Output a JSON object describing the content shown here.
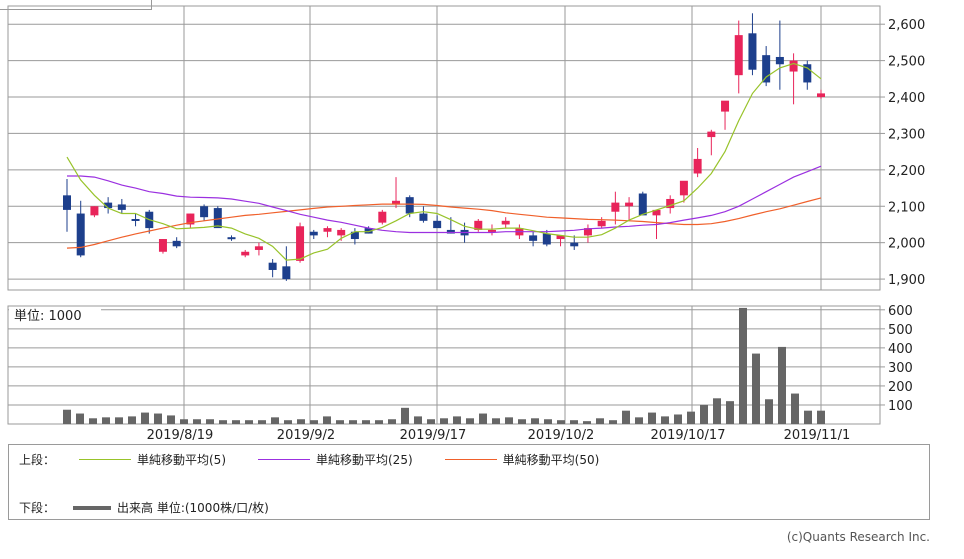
{
  "chart_data": {
    "type": "candlestick",
    "dates": [
      "2019-08-08",
      "2019-08-09",
      "2019-08-13",
      "2019-08-14",
      "2019-08-15",
      "2019-08-16",
      "2019-08-19",
      "2019-08-20",
      "2019-08-21",
      "2019-08-22",
      "2019-08-23",
      "2019-08-26",
      "2019-08-27",
      "2019-08-28",
      "2019-08-29",
      "2019-08-30",
      "2019-09-02",
      "2019-09-03",
      "2019-09-04",
      "2019-09-05",
      "2019-09-06",
      "2019-09-09",
      "2019-09-10",
      "2019-09-11",
      "2019-09-12",
      "2019-09-13",
      "2019-09-17",
      "2019-09-18",
      "2019-09-19",
      "2019-09-20",
      "2019-09-24",
      "2019-09-25",
      "2019-09-26",
      "2019-09-27",
      "2019-09-30",
      "2019-10-01",
      "2019-10-02",
      "2019-10-03",
      "2019-10-04",
      "2019-10-07",
      "2019-10-08",
      "2019-10-09",
      "2019-10-10",
      "2019-10-11",
      "2019-10-15",
      "2019-10-16",
      "2019-10-17",
      "2019-10-18",
      "2019-10-21",
      "2019-10-23",
      "2019-10-24",
      "2019-10-25",
      "2019-10-28",
      "2019-10-29",
      "2019-10-30",
      "2019-10-31"
    ],
    "candles": [
      [
        2130,
        2175,
        2030,
        2090
      ],
      [
        2080,
        2115,
        1960,
        1965
      ],
      [
        2075,
        2100,
        2070,
        2100
      ],
      [
        2110,
        2125,
        2080,
        2095
      ],
      [
        2105,
        2120,
        2080,
        2090
      ],
      [
        2065,
        2080,
        2045,
        2060
      ],
      [
        2085,
        2090,
        2025,
        2040
      ],
      [
        1975,
        2010,
        1970,
        2010
      ],
      [
        2005,
        2015,
        1985,
        1990
      ],
      [
        2050,
        2080,
        2040,
        2080
      ],
      [
        2100,
        2105,
        2060,
        2070
      ],
      [
        2095,
        2100,
        2050,
        2040
      ],
      [
        2015,
        2020,
        2005,
        2010
      ],
      [
        1965,
        1980,
        1960,
        1975
      ],
      [
        1980,
        2000,
        1965,
        1990
      ],
      [
        1945,
        1955,
        1905,
        1925
      ],
      [
        1935,
        1990,
        1895,
        1900
      ],
      [
        1950,
        2055,
        1945,
        2045
      ],
      [
        2030,
        2035,
        2010,
        2020
      ],
      [
        2030,
        2045,
        2015,
        2040
      ],
      [
        2020,
        2040,
        2005,
        2035
      ],
      [
        2030,
        2040,
        1995,
        2010
      ],
      [
        2040,
        2045,
        2025,
        2025
      ],
      [
        2055,
        2090,
        2050,
        2085
      ],
      [
        2105,
        2180,
        2095,
        2115
      ],
      [
        2125,
        2130,
        2070,
        2080
      ],
      [
        2080,
        2100,
        2055,
        2060
      ],
      [
        2060,
        2075,
        2045,
        2040
      ],
      [
        2035,
        2070,
        2025,
        2025
      ],
      [
        2035,
        2055,
        2000,
        2020
      ],
      [
        2035,
        2065,
        2030,
        2060
      ],
      [
        2030,
        2050,
        2020,
        2035
      ],
      [
        2050,
        2070,
        2040,
        2060
      ],
      [
        2020,
        2050,
        2010,
        2040
      ],
      [
        2020,
        2030,
        1990,
        2005
      ],
      [
        2025,
        2035,
        1990,
        1995
      ],
      [
        2010,
        2020,
        1990,
        2020
      ],
      [
        2000,
        2020,
        1980,
        1990
      ],
      [
        2020,
        2050,
        2000,
        2040
      ],
      [
        2045,
        2070,
        2040,
        2060
      ],
      [
        2085,
        2140,
        2050,
        2110
      ],
      [
        2100,
        2125,
        2060,
        2110
      ],
      [
        2135,
        2140,
        2085,
        2075
      ],
      [
        2075,
        2090,
        2010,
        2090
      ],
      [
        2095,
        2130,
        2080,
        2120
      ],
      [
        2130,
        2160,
        2110,
        2170
      ],
      [
        2190,
        2260,
        2180,
        2230
      ],
      [
        2290,
        2310,
        2240,
        2305
      ],
      [
        2360,
        2385,
        2310,
        2390
      ],
      [
        2460,
        2610,
        2410,
        2570
      ],
      [
        2575,
        2630,
        2460,
        2475
      ],
      [
        2515,
        2540,
        2430,
        2440
      ],
      [
        2510,
        2610,
        2420,
        2490
      ],
      [
        2470,
        2520,
        2380,
        2500
      ],
      [
        2490,
        2500,
        2420,
        2440
      ],
      [
        2400,
        2420,
        2395,
        2410
      ]
    ],
    "ma5": [
      2235,
      2172,
      2130,
      2095,
      2080,
      2080,
      2063,
      2052,
      2038,
      2040,
      2042,
      2046,
      2040,
      2024,
      2012,
      1990,
      1952,
      1955,
      1972,
      1982,
      2012,
      2030,
      2030,
      2042,
      2060,
      2080,
      2085,
      2080,
      2063,
      2045,
      2037,
      2037,
      2040,
      2040,
      2033,
      2025,
      2020,
      2015,
      2015,
      2022,
      2040,
      2062,
      2078,
      2090,
      2102,
      2115,
      2150,
      2190,
      2250,
      2335,
      2410,
      2455,
      2480,
      2492,
      2480,
      2450
    ],
    "ma25": [
      2183,
      2183,
      2180,
      2170,
      2158,
      2150,
      2140,
      2135,
      2128,
      2125,
      2124,
      2123,
      2120,
      2114,
      2108,
      2098,
      2088,
      2078,
      2070,
      2062,
      2056,
      2048,
      2040,
      2034,
      2030,
      2028,
      2028,
      2028,
      2028,
      2028,
      2028,
      2028,
      2030,
      2030,
      2030,
      2030,
      2032,
      2034,
      2038,
      2040,
      2043,
      2045,
      2048,
      2050,
      2055,
      2062,
      2068,
      2075,
      2085,
      2100,
      2120,
      2140,
      2160,
      2180,
      2195,
      2210
    ],
    "ma50": [
      1985,
      1987,
      1995,
      2005,
      2015,
      2024,
      2032,
      2040,
      2048,
      2055,
      2060,
      2065,
      2070,
      2075,
      2078,
      2082,
      2086,
      2090,
      2094,
      2098,
      2100,
      2102,
      2104,
      2106,
      2106,
      2106,
      2105,
      2102,
      2098,
      2095,
      2092,
      2088,
      2082,
      2078,
      2074,
      2070,
      2068,
      2066,
      2064,
      2063,
      2062,
      2060,
      2058,
      2055,
      2052,
      2050,
      2050,
      2052,
      2058,
      2066,
      2076,
      2085,
      2093,
      2103,
      2113,
      2123
    ],
    "volume": [
      75,
      55,
      30,
      35,
      35,
      40,
      60,
      55,
      45,
      25,
      25,
      25,
      20,
      20,
      20,
      20,
      35,
      20,
      25,
      20,
      40,
      20,
      20,
      20,
      20,
      25,
      85,
      40,
      25,
      30,
      40,
      30,
      55,
      30,
      35,
      25,
      30,
      25,
      20,
      20,
      15,
      30,
      20,
      70,
      35,
      60,
      40,
      50,
      65,
      100,
      135,
      120,
      610,
      370,
      130,
      405,
      160,
      70,
      70
    ],
    "price_ylim": [
      1870,
      2650
    ],
    "price_ticks": [
      "1,900",
      "2,000",
      "2,100",
      "2,200",
      "2,300",
      "2,400",
      "2,500",
      "2,600"
    ],
    "volume_ylim": [
      0,
      620
    ],
    "volume_ticks": [
      "100",
      "200",
      "300",
      "400",
      "500",
      "600"
    ],
    "volume_unit_label": "単位: 1000",
    "x_tick_labels": [
      "2019/8/19",
      "2019/9/2",
      "2019/9/17",
      "2019/10/2",
      "2019/10/17",
      "2019/11/1"
    ],
    "colors": {
      "up": "#e8245a",
      "down": "#1d3f8c",
      "ma5": "#98c32a",
      "ma25": "#9b30e0",
      "ma50": "#f0602b",
      "volume": "#666666",
      "grid": "#9a9a9a"
    },
    "grid": true
  },
  "legend": {
    "upper_label": "上段：",
    "lower_label": "下段：",
    "ma5_label": "単純移動平均(5)",
    "ma25_label": "単純移動平均(25)",
    "ma50_label": "単純移動平均(50)",
    "volume_label": "出来高 単位:(1000株/口/枚)"
  },
  "credit": "(c)Quants Research Inc."
}
